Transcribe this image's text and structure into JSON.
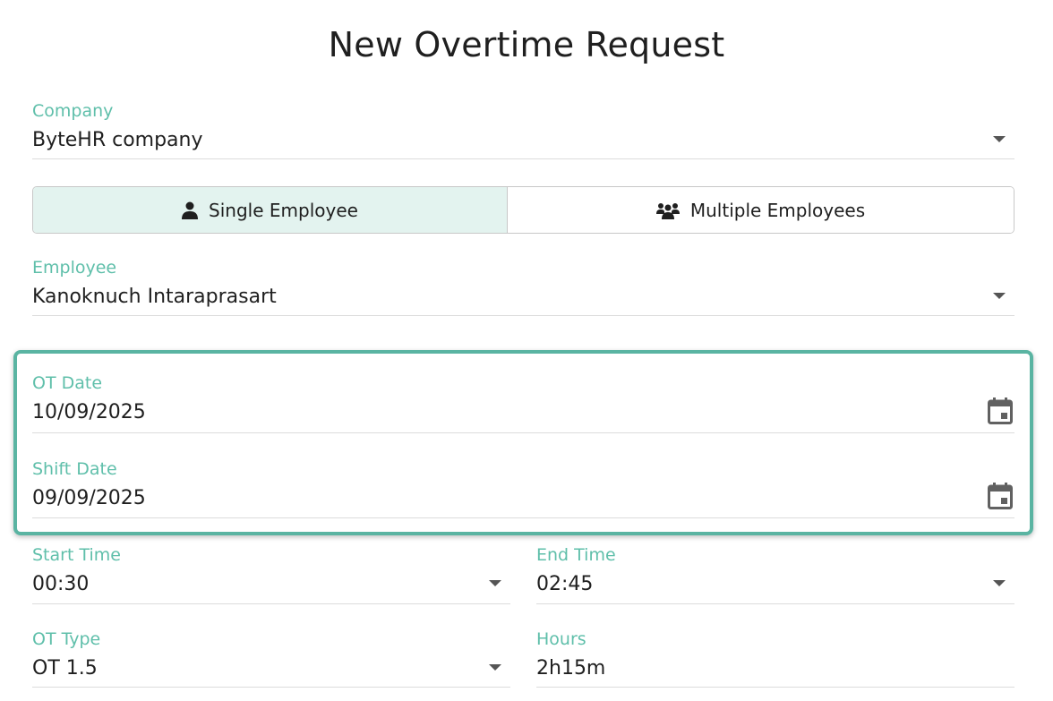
{
  "page": {
    "title": "New Overtime Request"
  },
  "company": {
    "label": "Company",
    "value": "ByteHR company"
  },
  "mode_toggle": {
    "single_label": "Single Employee",
    "multiple_label": "Multiple Employees",
    "selected": "single"
  },
  "employee": {
    "label": "Employee",
    "value": "Kanoknuch Intaraprasart"
  },
  "ot_date": {
    "label": "OT Date",
    "value": "10/09/2025"
  },
  "shift_date": {
    "label": "Shift Date",
    "value": "09/09/2025"
  },
  "start_time": {
    "label": "Start Time",
    "value": "00:30"
  },
  "end_time": {
    "label": "End Time",
    "value": "02:45"
  },
  "ot_type": {
    "label": "OT Type",
    "value": "OT 1.5"
  },
  "hours": {
    "label": "Hours",
    "value": "2h15m"
  },
  "colors": {
    "accent": "#5fbfaa",
    "highlight_border": "#5ab4a2",
    "active_segment": "#e3f3ef"
  },
  "icons": {
    "dropdown": "caret-down-icon",
    "single": "person-icon",
    "multiple": "people-group-icon",
    "calendar": "calendar-icon"
  }
}
